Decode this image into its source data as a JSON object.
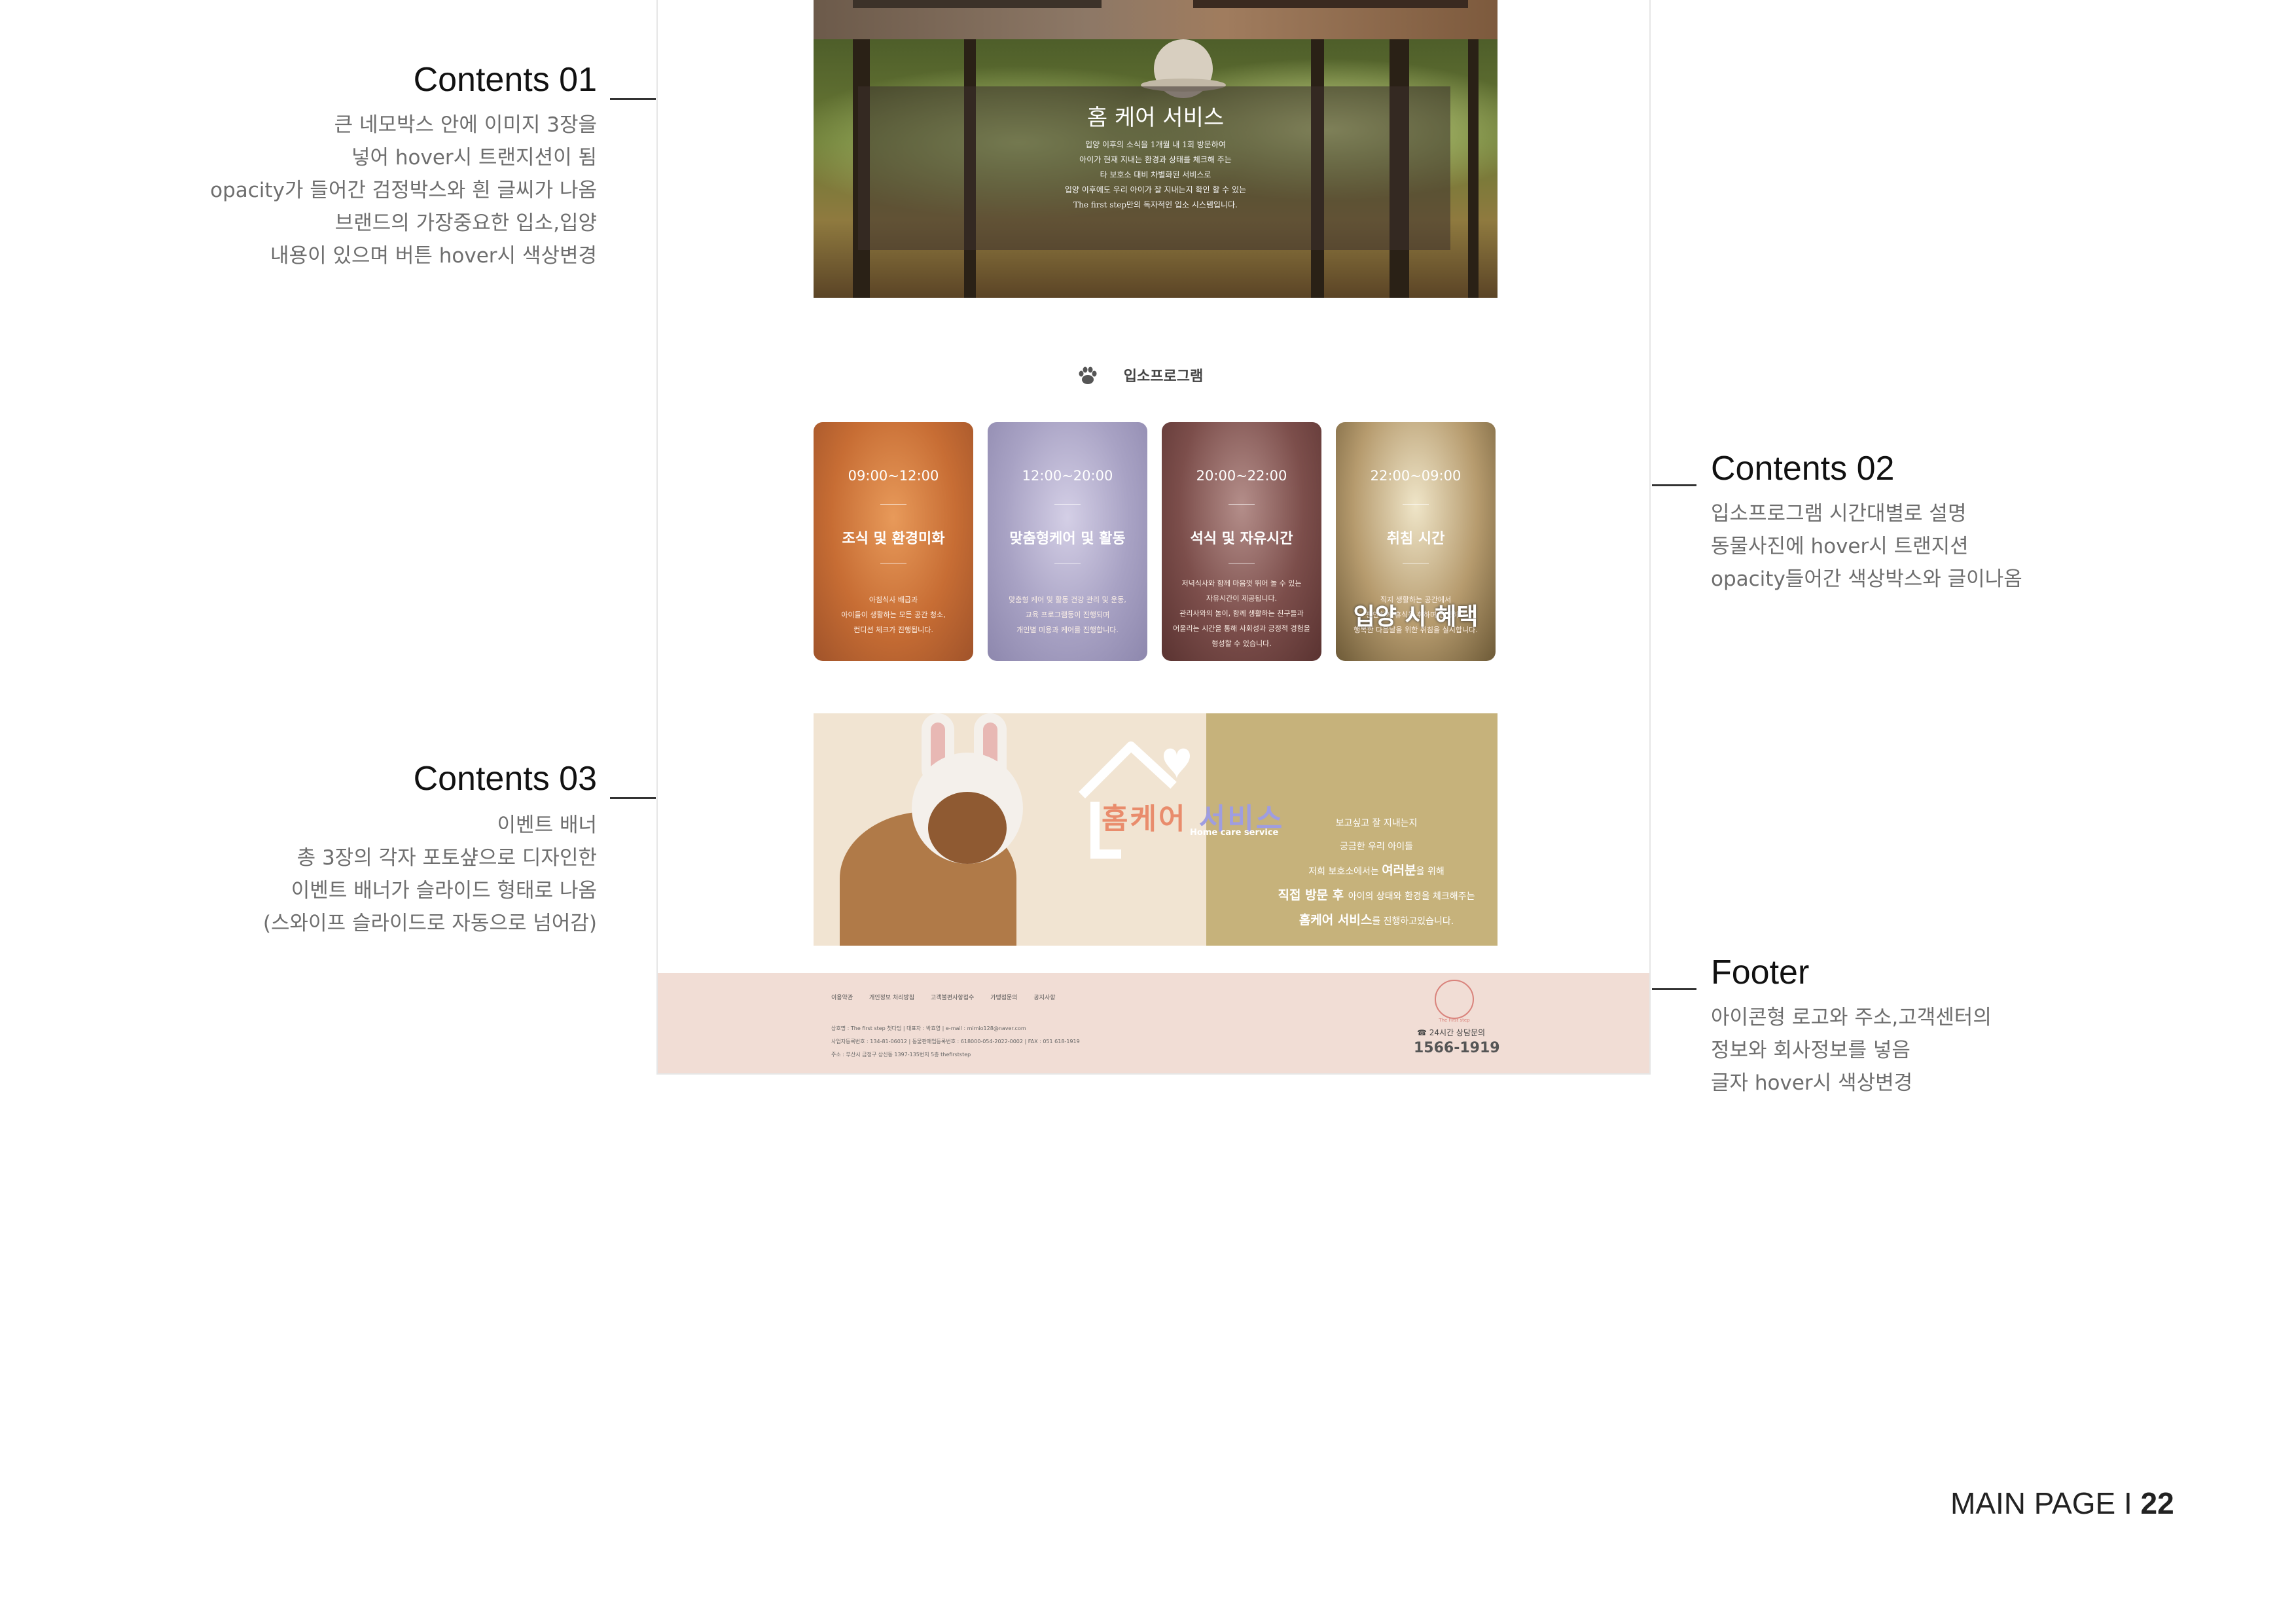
{
  "annotations": {
    "contents01": {
      "title": "Contents 01",
      "lines": [
        "큰 네모박스 안에 이미지 3장을",
        "넣어 hover시 트랜지션이 됨",
        "opacity가 들어간 검정박스와 흰 글씨가 나옴",
        "브랜드의 가장중요한 입소,입양",
        "내용이 있으며 버튼 hover시 색상변경"
      ]
    },
    "contents02": {
      "title": "Contents 02",
      "lines": [
        "입소프로그램 시간대별로 설명",
        "동물사진에 hover시 트랜지션",
        "opacity들어간 색상박스와 글이나옴"
      ]
    },
    "contents03": {
      "title": "Contents 03",
      "lines": [
        "이벤트 배너",
        "총 3장의 각자 포토샾으로 디자인한",
        "이벤트 배너가 슬라이드 형태로 나옴",
        "(스와이프 슬라이드로 자동으로 넘어감)"
      ]
    },
    "footer": {
      "title": "Footer",
      "lines": [
        "아이콘형 로고와 주소,고객센터의",
        "정보와 회사정보를 넣음",
        "글자 hover시 색상변경"
      ]
    }
  },
  "hero": {
    "title": "홈 케어 서비스",
    "desc": [
      "입양 이후의 소식을 1개월 내 1회 방문하여",
      "아이가 현재 지내는 환경과 상태를 체크해 주는",
      "타 보호소 대비 차별화된 서비스로",
      "입양 이후에도 우리 아이가 잘 지내는지 확인 할 수 있는",
      "The first step만의 독자적인 입소 시스템입니다."
    ]
  },
  "program": {
    "heading": "입소프로그램",
    "cards": [
      {
        "time": "09:00~12:00",
        "name": "조식 및 환경미화",
        "desc": [
          "아침식사 배급과",
          "아이들이 생활하는 모든 공간 청소,",
          "컨디션 체크가 진행됩니다."
        ]
      },
      {
        "time": "12:00~20:00",
        "name": "맞춤형케어 및 활동",
        "desc": [
          "맞춤형 케어 및 활동 건강 관리 및 운동,",
          "교육 프로그램등이 진행되며",
          "개인별 미용과 케어를 진행합니다."
        ]
      },
      {
        "time": "20:00~22:00",
        "name": "석식 및 자유시간",
        "desc": [
          "저녁식사와 함께 마음껏 뛰어 놀 수 있는",
          "자유시간이 제공됩니다.",
          "관리사와의 놀이, 함께 생활하는 친구들과",
          "어울리는 시간을 통해 사회성과 긍정적 경험을",
          "형성할 수 있습니다."
        ]
      },
      {
        "time": "22:00~09:00",
        "name": "취침 시간",
        "desc": [
          "직지 생활하는 공간에서",
          "편안하게 휴식을 취하며 안정하고",
          "행복한 다음날을 위한 취침을 실시합니다."
        ],
        "overlay": "입양 시 혜택"
      }
    ]
  },
  "banner": {
    "title_a": "홈케어",
    "title_b": "서비스",
    "subtitle": "Home care service",
    "line1": "보고싶고 잘 지내는지",
    "line2": "궁금한 우리 아이들",
    "line3a": "저희 보호소에서는 ",
    "line3b": "여러분",
    "line3c": "을 위해",
    "line4a": "직접 방문 후 ",
    "line4b": "아이의 상태와 환경을 체크해주는",
    "line5a": "홈케어 서비스",
    "line5b": "를 진행하고있습니다."
  },
  "footer": {
    "nav": [
      "이용약관",
      "개인정보 처리방침",
      "고객불편사항접수",
      "가맹점문의",
      "공지사항"
    ],
    "info": [
      "상호명 : The first step 첫다딤   |   대표자 : 박효영   |   e-mail : mimio128@naver.com",
      "사업자등록번호 : 134-81-06012   |   동물판매업등록번호 : 618000-054-2022-0002   |   FAX : 051 618-1919",
      "주소 : 부산시 금정구 상신동 1397-135번지 5층 thefirststep"
    ],
    "logo_text": "The First step",
    "cs_label": "24시간 상담문의",
    "phone": "1566-1919"
  },
  "page_label": {
    "text": "MAIN PAGE I ",
    "number": "22"
  }
}
